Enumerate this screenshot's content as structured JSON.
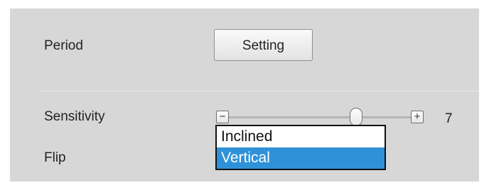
{
  "labels": {
    "period": "Period",
    "sensitivity": "Sensitivity",
    "flip": "Flip"
  },
  "period": {
    "button_label": "Setting"
  },
  "sensitivity_slider": {
    "minus_label": "−",
    "plus_label": "+",
    "value": "7",
    "fraction": 0.7
  },
  "flip_dropdown": {
    "options": [
      "Inclined",
      "Vertical"
    ],
    "highlighted": "Vertical"
  },
  "colors": {
    "panel_bg": "#d7d7d7",
    "highlight": "#2f92d8"
  }
}
